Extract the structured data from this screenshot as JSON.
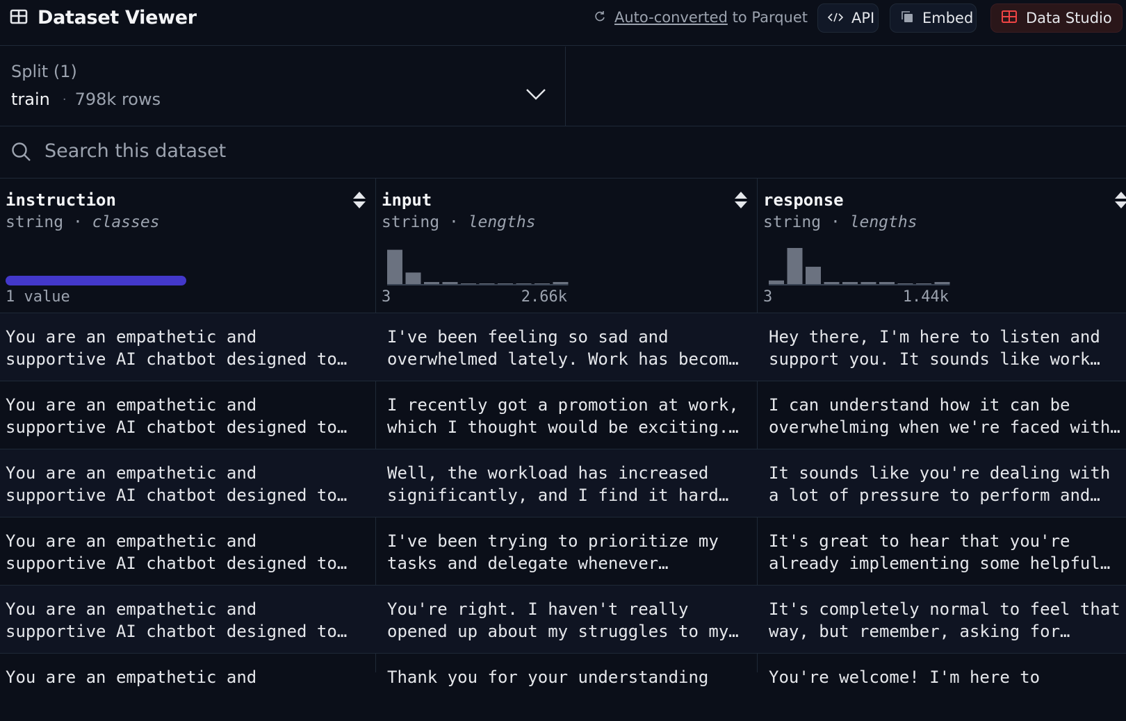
{
  "header": {
    "title": "Dataset Viewer",
    "convert_link": "Auto-converted",
    "convert_suffix": "to Parquet",
    "api_label": "API",
    "embed_label": "Embed",
    "studio_label": "Data Studio"
  },
  "split": {
    "label": "Split (1)",
    "name": "train",
    "dot": "·",
    "rows": "798k rows"
  },
  "search": {
    "placeholder": "Search this dataset"
  },
  "columns": [
    {
      "name": "instruction",
      "type": "string",
      "sep": " · ",
      "stat": "classes",
      "left_label": "1 value",
      "fill": 1.0
    },
    {
      "name": "input",
      "type": "string",
      "sep": " · ",
      "stat": "lengths",
      "min": "3",
      "max": "2.66k",
      "hist": [
        0.95,
        0.32,
        0.03,
        0.02,
        0.0,
        0.0,
        0.0,
        0.0,
        0.0,
        0.02
      ]
    },
    {
      "name": "response",
      "type": "string",
      "sep": " · ",
      "stat": "lengths",
      "min": "3",
      "max": "1.44k",
      "hist": [
        0.1,
        1.0,
        0.48,
        0.03,
        0.02,
        0.02,
        0.02,
        0.0,
        0.0,
        0.02
      ]
    }
  ],
  "rows": [
    {
      "instruction": [
        "You are an empathetic and",
        "supportive AI chatbot designed to…"
      ],
      "input": [
        "I've been feeling so sad and",
        "overwhelmed lately. Work has becom…"
      ],
      "response": [
        "Hey there, I'm here to listen and",
        "support you. It sounds like work…"
      ]
    },
    {
      "instruction": [
        "You are an empathetic and",
        "supportive AI chatbot designed to…"
      ],
      "input": [
        "I recently got a promotion at work,",
        "which I thought would be exciting.…"
      ],
      "response": [
        "I can understand how it can be",
        "overwhelming when we're faced with…"
      ]
    },
    {
      "instruction": [
        "You are an empathetic and",
        "supportive AI chatbot designed to…"
      ],
      "input": [
        "Well, the workload has increased",
        "significantly, and I find it hard…"
      ],
      "response": [
        "It sounds like you're dealing with",
        "a lot of pressure to perform and…"
      ]
    },
    {
      "instruction": [
        "You are an empathetic and",
        "supportive AI chatbot designed to…"
      ],
      "input": [
        "I've been trying to prioritize my",
        "tasks and delegate whenever…"
      ],
      "response": [
        "It's great to hear that you're",
        "already implementing some helpful…"
      ]
    },
    {
      "instruction": [
        "You are an empathetic and",
        "supportive AI chatbot designed to…"
      ],
      "input": [
        "You're right. I haven't really",
        "opened up about my struggles to my…"
      ],
      "response": [
        "It's completely normal to feel that",
        "way, but remember, asking for…"
      ]
    },
    {
      "instruction": [
        "You are an empathetic and",
        ""
      ],
      "input": [
        "Thank you for your understanding",
        ""
      ],
      "response": [
        "You're welcome! I'm here to",
        ""
      ]
    }
  ],
  "colors": {
    "background": "#0b0f19",
    "accent_bar": "#4338ca",
    "studio_icon": "#ef4444",
    "histogram": "#6b7280"
  },
  "icons": {
    "title": "table-icon",
    "convert": "refresh-icon",
    "api": "code-icon",
    "embed": "copy-icon",
    "studio": "grid-icon",
    "caret": "chevron-down-icon",
    "search": "search-icon",
    "sort": "sort-icon"
  }
}
